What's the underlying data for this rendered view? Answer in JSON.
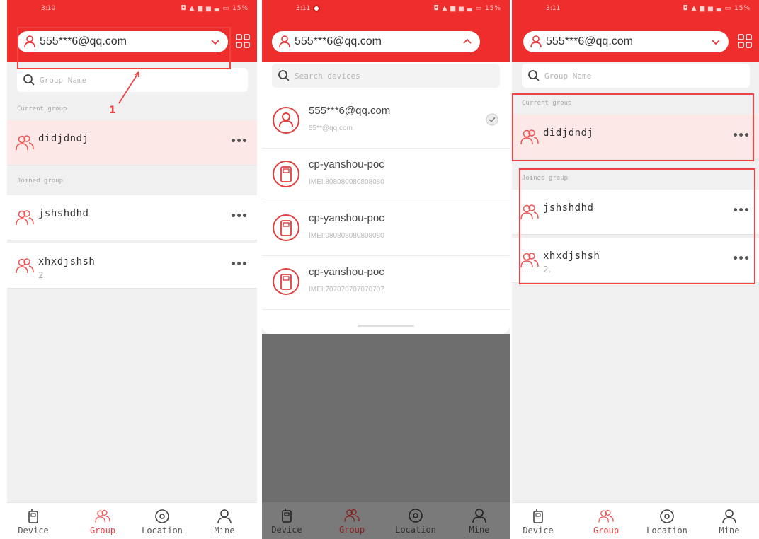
{
  "account": {
    "email": "555***6@qq.com"
  },
  "status": {
    "time_1": "3:10",
    "time_2": "3:11",
    "time_3": "3:11",
    "icons": "◘ ▲ ▆ ▅ ▃ ▭ 15%"
  },
  "search": {
    "group_placeholder": "Group Name",
    "device_placeholder": "Search devices"
  },
  "sections": {
    "current": "Current group",
    "joined": "Joined group"
  },
  "groups": {
    "current": {
      "name": "didjdndj"
    },
    "joined": [
      {
        "name": "jshshdhd",
        "sub": ""
      },
      {
        "name": "xhxdjshsh",
        "sub": "2."
      }
    ],
    "more_label": "•••"
  },
  "devices": [
    {
      "title": "555***6@qq.com",
      "sub": "55**@qq.com",
      "icon": "user-icon",
      "selected": true
    },
    {
      "title": "cp-yanshou-poc",
      "sub": "IMEI:808080080808080",
      "icon": "radio-device-icon"
    },
    {
      "title": "cp-yanshou-poc",
      "sub": "IMEI:080808080808080",
      "icon": "radio-device-icon"
    },
    {
      "title": "cp-yanshou-poc",
      "sub": "IMEI:707070707070707",
      "icon": "radio-device-icon"
    }
  ],
  "nav": {
    "device": "Device",
    "group": "Group",
    "location": "Location",
    "mine": "Mine"
  },
  "annotation": {
    "step": "1"
  },
  "colors": {
    "brand_red": "#f02d2d",
    "active_tab": "#e64545",
    "current_row": "#fde8e8",
    "annotation": "#e44444"
  }
}
